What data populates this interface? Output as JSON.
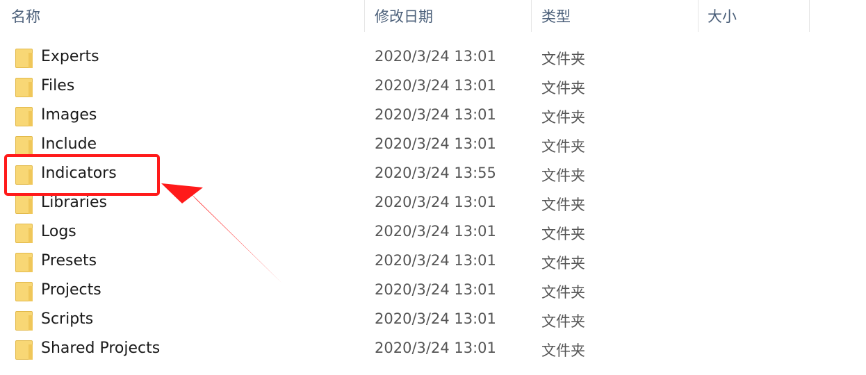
{
  "columns": {
    "name": "名称",
    "date": "修改日期",
    "type": "类型",
    "size": "大小"
  },
  "rows": [
    {
      "name": "Experts",
      "date": "2020/3/24 13:01",
      "type": "文件夹"
    },
    {
      "name": "Files",
      "date": "2020/3/24 13:01",
      "type": "文件夹"
    },
    {
      "name": "Images",
      "date": "2020/3/24 13:01",
      "type": "文件夹"
    },
    {
      "name": "Include",
      "date": "2020/3/24 13:01",
      "type": "文件夹"
    },
    {
      "name": "Indicators",
      "date": "2020/3/24 13:55",
      "type": "文件夹"
    },
    {
      "name": "Libraries",
      "date": "2020/3/24 13:01",
      "type": "文件夹"
    },
    {
      "name": "Logs",
      "date": "2020/3/24 13:01",
      "type": "文件夹"
    },
    {
      "name": "Presets",
      "date": "2020/3/24 13:01",
      "type": "文件夹"
    },
    {
      "name": "Projects",
      "date": "2020/3/24 13:01",
      "type": "文件夹"
    },
    {
      "name": "Scripts",
      "date": "2020/3/24 13:01",
      "type": "文件夹"
    },
    {
      "name": "Shared Projects",
      "date": "2020/3/24 13:01",
      "type": "文件夹"
    }
  ],
  "annotation": {
    "highlighted": "Indicators",
    "color": "#ff1a1a"
  }
}
